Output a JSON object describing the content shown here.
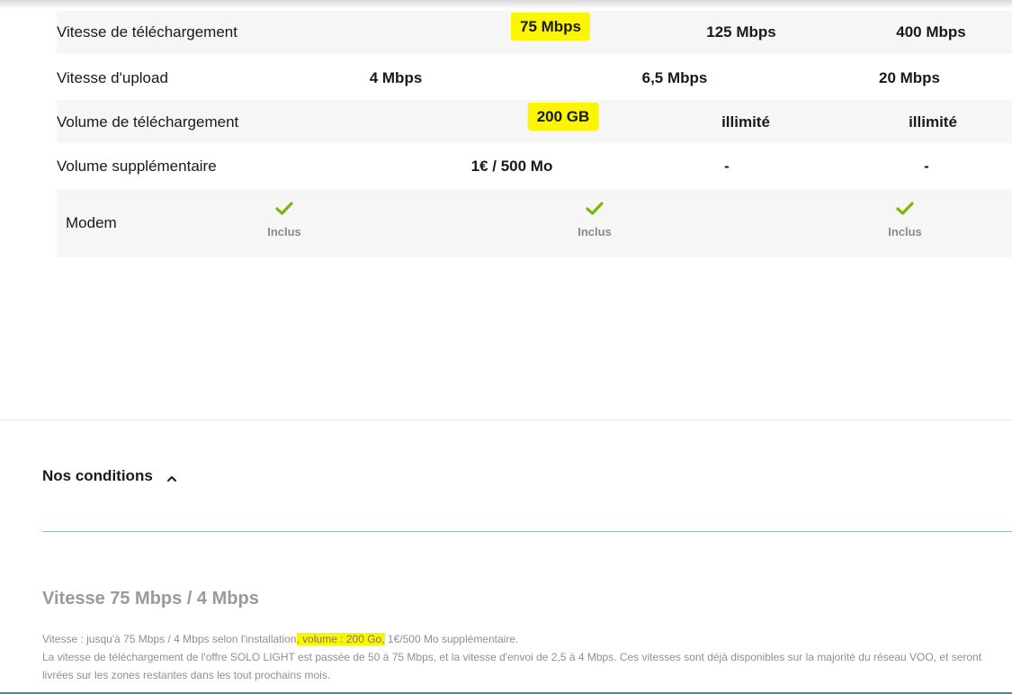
{
  "table": {
    "rows": [
      {
        "label": "Vitesse de téléchargement",
        "values": [
          "75 Mbps",
          "125 Mbps",
          "400 Mbps"
        ]
      },
      {
        "label": "Vitesse d'upload",
        "values": [
          "4 Mbps",
          "6,5 Mbps",
          "20 Mbps"
        ]
      },
      {
        "label": "Volume de téléchargement",
        "values": [
          "200 GB",
          "illimité",
          "illimité"
        ]
      },
      {
        "label": "Volume supplémentaire",
        "values": [
          "1€ / 500 Mo",
          "-",
          "-"
        ]
      }
    ],
    "modem": {
      "label": "Modem",
      "included_label": "Inclus",
      "icon": "check-icon"
    }
  },
  "conditions": {
    "title": "Nos conditions",
    "toggle_icon": "chevron-up-icon",
    "speed_heading": "Vitesse 75 Mbps / 4 Mbps",
    "line1_a": "Vitesse : jusqu'à 75 Mbps / 4 Mbps selon l'installation",
    "line1_b": ", volume : 200 Go,",
    "line1_c": " 1€/500 Mo supplémentaire.",
    "line2": "La vitesse de téléchargement de l'offre SOLO LIGHT est passée de 50 à 75 Mbps, et la vitesse d'envoi de 2,5 à 4 Mbps. Ces vitesses sont déjà disponibles sur la majorité du réseau VOO, et seront livrées sur les zones restantes dans les tout prochains mois."
  },
  "colors": {
    "highlight": "#fbf500",
    "check": "#7ab800",
    "accent_line": "#2f8fb5"
  }
}
